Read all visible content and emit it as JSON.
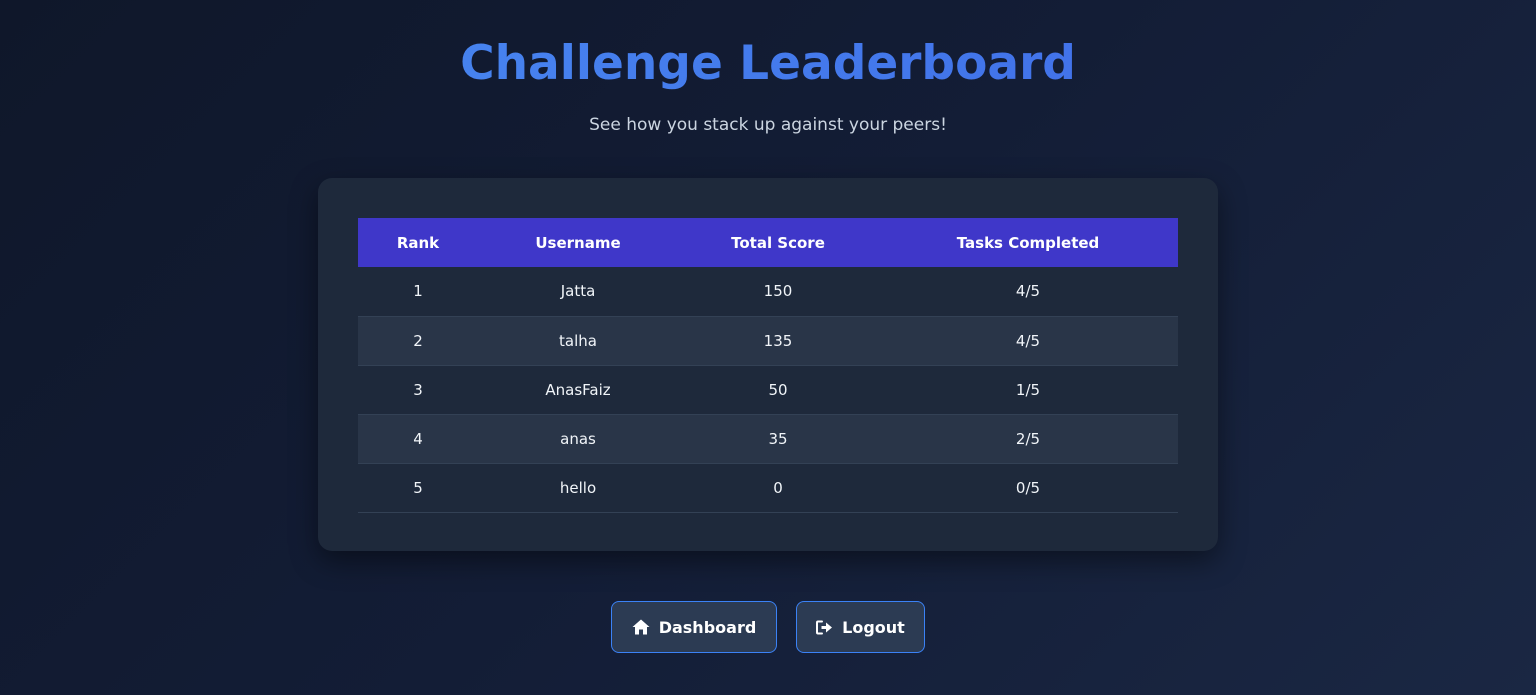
{
  "header": {
    "title": "Challenge Leaderboard",
    "subtitle": "See how you stack up against your peers!"
  },
  "leaderboard": {
    "columns": [
      "Rank",
      "Username",
      "Total Score",
      "Tasks Completed"
    ],
    "rows": [
      {
        "rank": "1",
        "username": "Jatta",
        "score": "150",
        "tasks": "4/5"
      },
      {
        "rank": "2",
        "username": "talha",
        "score": "135",
        "tasks": "4/5"
      },
      {
        "rank": "3",
        "username": "AnasFaiz",
        "score": "50",
        "tasks": "1/5"
      },
      {
        "rank": "4",
        "username": "anas",
        "score": "35",
        "tasks": "2/5"
      },
      {
        "rank": "5",
        "username": "hello",
        "score": "0",
        "tasks": "0/5"
      }
    ]
  },
  "actions": {
    "dashboard_label": "Dashboard",
    "dashboard_icon": "home-icon",
    "logout_label": "Logout",
    "logout_icon": "sign-out-icon"
  },
  "colors": {
    "accent": "#3b82f6",
    "header_row": "#3f37c9",
    "card": "#1e293b",
    "background": "#0f172a"
  }
}
